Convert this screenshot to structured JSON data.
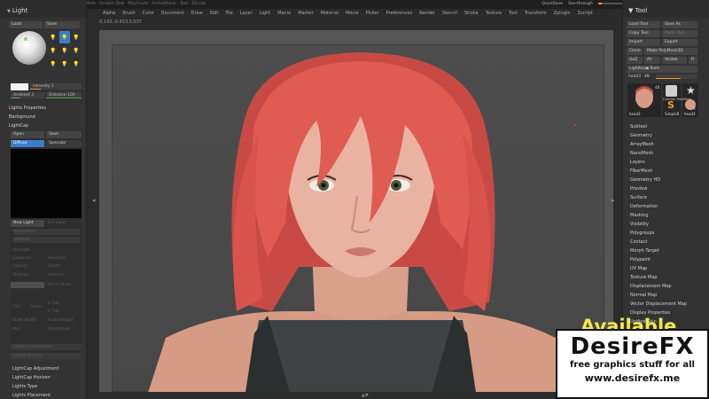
{
  "titlebar": {
    "text": "ZBrush 2019.1 · GoZ · Active Mem · Free Mem · Scratch Disk · PolyCount · ActivePoints · Tool · ZScript",
    "quicksave": "QuickSave",
    "see_through_label": "See-through",
    "see_through_value": "0",
    "see_through_level": 0.15,
    "menus_button": "Menus",
    "script": "DefaultZScript"
  },
  "menubar": [
    "Alpha",
    "Brush",
    "Color",
    "Document",
    "Draw",
    "Edit",
    "File",
    "Layer",
    "Light",
    "Macro",
    "Marker",
    "Material",
    "Movie",
    "Picker",
    "Preferences",
    "Render",
    "Stencil",
    "Stroke",
    "Texture",
    "Tool",
    "Transform",
    "Zplugin",
    "Zscript"
  ],
  "coords": "0.143,-0.433,0.037",
  "light_panel": {
    "title": "Light",
    "load": "Load",
    "save": "Save",
    "intensity_label": "Intensity",
    "intensity_value": "1",
    "ambient_label": "Ambient",
    "ambient_value": "3",
    "distance_label": "Distance",
    "distance_value": "100",
    "items": [
      "Lights Properties",
      "Background",
      "LightCap"
    ],
    "lightcap_open": "Open",
    "lightcap_save": "Save",
    "diffuse_tab": "Diffuse",
    "specular_tab": "Specular",
    "new_light": "New Light",
    "del_light": "Del Light",
    "dim_controls": [
      "Horizontal",
      "Vertical",
      "Strength",
      "Exposure",
      "Aperture",
      "Opacity",
      "Falloff",
      "Shadow",
      "Gamma",
      "Color",
      "Blend Mode",
      "Tint",
      "Alpha",
      "H Tile",
      "V Tile",
      "Scale Width",
      "Scale Height",
      "Blur",
      "Orientation",
      "Create Environment",
      "Create Texture"
    ],
    "footer": [
      "LightCap Adjustment",
      "LightCap Horizon",
      "Lights Type",
      "Lights Placement"
    ]
  },
  "tool_panel": {
    "title": "Tool",
    "load_tool": "Load Tool",
    "save_as": "Save As",
    "copy_tool": "Copy Tool",
    "paste_tool": "Paste Tool",
    "import": "Import",
    "export": "Export",
    "clone": "Clone",
    "make_polymesh": "Make PolyMesh3D",
    "goz": "GoZ",
    "all": "All",
    "visible": "Visible",
    "r": "R",
    "lightbox_tools": "Lightbox▶Tools",
    "current_tool": "head3",
    "current_value": "48",
    "thumbs": [
      "head3",
      "SimpleB",
      "head3"
    ],
    "thumb_extra": [
      "48",
      "Cylinder PolyMesh",
      "R"
    ],
    "menu": [
      "Subtool",
      "Geometry",
      "ArrayMesh",
      "NanoMesh",
      "Layers",
      "FiberMesh",
      "Geometry HD",
      "Preview",
      "Surface",
      "Deformation",
      "Masking",
      "Visibility",
      "Polygroups",
      "Contact",
      "Morph Target",
      "Polypaint",
      "UV Map",
      "Texture Map",
      "Displacement Map",
      "Normal Map",
      "Vector Displacement Map",
      "Display Properties",
      "Unified Skin"
    ]
  },
  "watermark": {
    "available": "Available",
    "logo": "DesireFX",
    "tagline": "free graphics stuff for all",
    "url": "www.desirefx.me"
  }
}
